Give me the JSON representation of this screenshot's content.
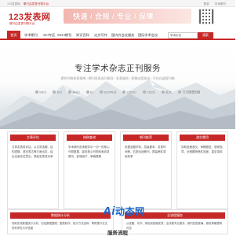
{
  "topbar": {
    "left_a": "123发表网",
    "left_b": "哪只由发表刊物平台",
    "right_items": [
      "登录",
      "学术期刊"
    ]
  },
  "header": {
    "logo_title": "123发表网",
    "logo_sub": "哪只由发表刊物平台",
    "banner_text": "快速 / 合规 / 专业 / 保障"
  },
  "nav": {
    "items": [
      "首页",
      "学术期刊",
      "SCI专区",
      "SSCI期刊",
      "知识百科",
      "论文写作",
      "国内外会议服务",
      "国际学术会议"
    ],
    "search_value": "学术杂志",
    "search_button": "搜索"
  },
  "hero": {
    "title": "专注学术杂志正刊服务",
    "subtitle": "提供刊物发表指南 / 期刊发表选刊指导 / 发表服务 / 投稿全程协议 / 不存在虚假刊物",
    "databases": [
      "SSCI",
      "SCI",
      "AHCI",
      "EI",
      "SCOPUS",
      "CSSCI",
      "CSCD",
      "北大",
      "万方维普知网"
    ]
  },
  "cards": [
    {
      "title": "文章评估",
      "body": "文章发表前评估，从文章选题、结构逻辑、语言表达等方面出发，给出全面评估意见，提高发表成功率"
    },
    {
      "title": "按刷查询",
      "body": "学术期刊查询服务中一切一的核心刊物数据，能查核心刊物检索收录情况、影响因子、审稿周期"
    },
    {
      "title": "期刊推荐",
      "body": "依据选题学科、层级要求、发表时间等，匹配合适期刊，提高稿件录用效率"
    },
    {
      "title": "递交需用",
      "body": "协助投稿递交、审稿跟进、退修指导，全程跟踪稿件进度，直至录用"
    }
  ],
  "wide_cards": [
    {
      "title": "数据统计分析",
      "body": "协助完成数据统计分析，包括数据整理、图表制作、统计方法选择，帮助提升论文的科学性与可信度"
    },
    {
      "title": "全流程服务",
      "body": "从选题、写作、润色到投稿发表，全流程专业服务，期刊匹配准确，服务周期透明可控"
    }
  ],
  "overlay": {
    "logo_latin": "Ai",
    "logo_cn": "动态网"
  },
  "section": {
    "title": "服务流程"
  }
}
